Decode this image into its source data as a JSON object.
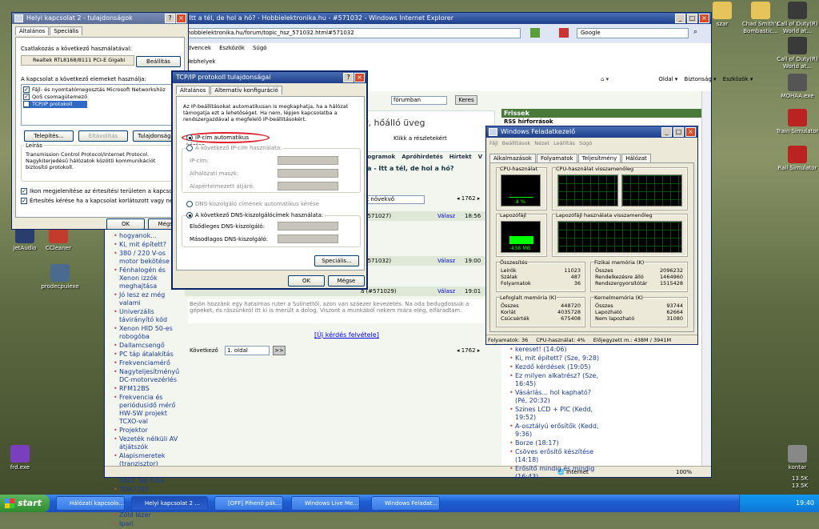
{
  "desktop": {
    "left_icons": [
      "jetAudio",
      "CCleaner",
      "prodecpulexe",
      "frd.exe"
    ],
    "right_icons": [
      "Chad Smith's Bombastic...",
      "Call of Duty(R) World at...",
      "Call of Duty(R) World at...",
      "MOHAA.exe",
      "Train Simulator",
      "Rail Simulator",
      "kontar"
    ],
    "top_icons": [
      "szar"
    ]
  },
  "ie": {
    "title": "hobbielektronika.hu - Itt a tél, de hol a hó? - Hobbielektronika.hu - #571032 - Windows Internet Explorer",
    "url": "hobbielektronika.hu/forum/topic_hsz_571032.html#571032",
    "search_placeholder": "Google",
    "menu": [
      "Kedvencek",
      "Eszközök",
      "Súgó"
    ],
    "favorites": "Webhelyek",
    "cmd": [
      "Oldal",
      "Biztonság",
      "Eszközök"
    ],
    "search_scope": "fórumban",
    "search_btn": "Keres",
    "banner": "r, hőálló üveg",
    "banner_link": "Klikk a részletekért",
    "nav_links": [
      "programok",
      "Apróhirdetés",
      "Hírtekt",
      "V"
    ],
    "topic": "ája - Itt a tél, de hol a hó?",
    "order": "nt növekvő",
    "page_count": "1762",
    "posts": [
      {
        "id": "(#571027)",
        "reply": "Válasz",
        "time": "18:56"
      },
      {
        "id": "(#571032)",
        "reply": "Válasz",
        "time": "19:00"
      },
      {
        "id": "a (#571029)",
        "reply": "Válasz",
        "time": "19:01"
      }
    ],
    "post_text": "Bejön hozzánk egy hatalmas ruter a Sulinettől, azon van száezer kevezetés. Na oda bedugdossuk a gépeket, és rászúnkról itt ki is merült a dolog. Viszont a munkából nekem mára elég, elfáradtam.",
    "new_question": "[Új kérdés felvétele]",
    "next": "Következő",
    "page_sel": "1. oldal",
    "go": ">>",
    "status": "Internet",
    "zoom": "100%",
    "right_title": "Frissek",
    "right_sub": "RSS hírforrások",
    "left_topics": [
      "hogyanok...",
      "Ki, mit épített?",
      "380 / 220 V-os motor bekötése",
      "Fénhalogén és Xenon izzók meghajtása",
      "Jó lesz ez még valami",
      "Univerzális távirányító kód",
      "Xenon HID 50-es robogóba",
      "Dallamcsengő",
      "PC táp átalakítás",
      "Frekvenciamérő",
      "Nagyteljesítményű DC-motorvezérlés",
      "RFM12BS",
      "Frekvencia és periódusidő mérő HW-SW projekt TCXO-val",
      "Projektor",
      "Vezeték nélküli AV átjátszók",
      "Alapismeretek (tranzisztor)",
      "Euromarkt DVD 3602 Táp hiba",
      "TDA7293 végerősítő",
      "BIO-vízbontás",
      "Zöld lézer",
      "Ipari"
    ],
    "right_topics": [
      "kereset! (14:06)",
      "Ki, mit épített? (Sze, 9:28)",
      "Kezdő kérdések (19:05)",
      "Ez milyen alkatrész? (Sze, 16:45)",
      "Vásárlás... hol kapható? (Pé, 20:32)",
      "Színes LCD + PIC (Kedd, 19:52)",
      "A-osztályú erősítők (Kedd, 9:36)",
      "Borze (18:17)",
      "Csöves erősítő készítése (14:18)",
      "Erősítő mindig és mindig (16:43)"
    ]
  },
  "lan": {
    "title": "Helyi kapcsolat 2 - tulajdonságok",
    "tabs": [
      "Általános",
      "Speciális"
    ],
    "connect_using": "Csatlakozás a következő használatával:",
    "adapter": "Realtek RTL8168/8111 PCI-E Gigabi",
    "config_btn": "Beállítás",
    "items_label": "A kapcsolat a következő elemeket használja:",
    "items": [
      "Fájl- és nyomtatómegosztás Microsoft Networkshöz",
      "QoS csomagütemező",
      "TCP/IP protokoll"
    ],
    "install": "Telepítés...",
    "uninstall": "Eltávolítás",
    "props": "Tulajdonságok",
    "desc_title": "Leírás",
    "desc": "Transmission Control Protocol/Internet Protocol. Nagykiterjedésű hálózatok közötti kommunikációt biztosító protokoll.",
    "chk1": "Ikon megjelenítése az értesítési területen a kapcsolat ideje alatt",
    "chk2": "Értesítés kérése ha a kapcsolat korlátozott vagy nem jött létre",
    "ok": "OK",
    "cancel": "Mégse"
  },
  "tcp": {
    "title": "TCP/IP protokoll tulajdonságai",
    "tabs": [
      "Általános",
      "Alternatív konfiguráció"
    ],
    "intro": "Az IP-beállításokat automatikusan is megkaphatja, ha a hálózat támogatja ezt a lehetőséget. Ha nem, lépjen kapcsolatba a rendszergazdával a megfelelő IP-beállításokért.",
    "auto_ip": "IP-cím automatikus kérése",
    "manual_ip": "A következő IP-cím használata:",
    "ip": "IP-cím:",
    "mask": "Alhálózati maszk:",
    "gw": "Alapértelmezett átjáró:",
    "auto_dns": "DNS-kiszolgáló címének automatikus kérése",
    "manual_dns": "A következő DNS-kiszolgálócímek használata:",
    "dns1": "Elsődleges DNS-kiszolgáló:",
    "dns2": "Másodlagos DNS-kiszolgáló:",
    "adv": "Speciális...",
    "ok": "OK",
    "cancel": "Mégse"
  },
  "tm": {
    "title": "Windows Feladatkezelő",
    "menu": [
      "Fájl",
      "Beállítások",
      "Nézet",
      "Leállítás",
      "Súgó"
    ],
    "tabs": [
      "Alkalmazások",
      "Folyamatok",
      "Teljesítmény",
      "Hálózat"
    ],
    "cpu_label": "CPU-használat",
    "cpu_hist": "CPU-használat visszamenőleg",
    "cpu_val": "4 %",
    "pf_label": "Lapozófájl",
    "pf_hist": "Lapozófájl használata visszamenőleg",
    "pf_val": "438 MB",
    "totals": {
      "title": "Összesítés",
      "rows": [
        [
          "Leírók",
          "11023"
        ],
        [
          "Szálak",
          "487"
        ],
        [
          "Folyamatok",
          "36"
        ]
      ]
    },
    "phys": {
      "title": "Fizikai memória (K)",
      "rows": [
        [
          "Összes",
          "2096232"
        ],
        [
          "Rendelkezésre álló",
          "1464960"
        ],
        [
          "Rendszergyorsítótár",
          "1515428"
        ]
      ]
    },
    "commit": {
      "title": "Lefoglalt memória (K)",
      "rows": [
        [
          "Összes",
          "448720"
        ],
        [
          "Korlát",
          "4035728"
        ],
        [
          "Csúcsérték",
          "675408"
        ]
      ]
    },
    "kernel": {
      "title": "Kernelmemória (K)",
      "rows": [
        [
          "Összes",
          "93744"
        ],
        [
          "Lapozható",
          "62664"
        ],
        [
          "Nem lapozható",
          "31080"
        ]
      ]
    },
    "status": [
      "Folyamatok: 36",
      "CPU-használat: 4%",
      "Előjegyzett m.: 438M / 3941M"
    ],
    "cpu_percent": 4
  },
  "taskbar": {
    "start": "start",
    "tasks": [
      "Hálózati kapcsola...",
      "Helyi kapcsolat 2 ...",
      "[OFF] Pihenő pák...",
      "Windows Live Me...",
      "Windows Feladat..."
    ],
    "clock": "19:40",
    "net": [
      "13.5K",
      "13.5K"
    ]
  }
}
